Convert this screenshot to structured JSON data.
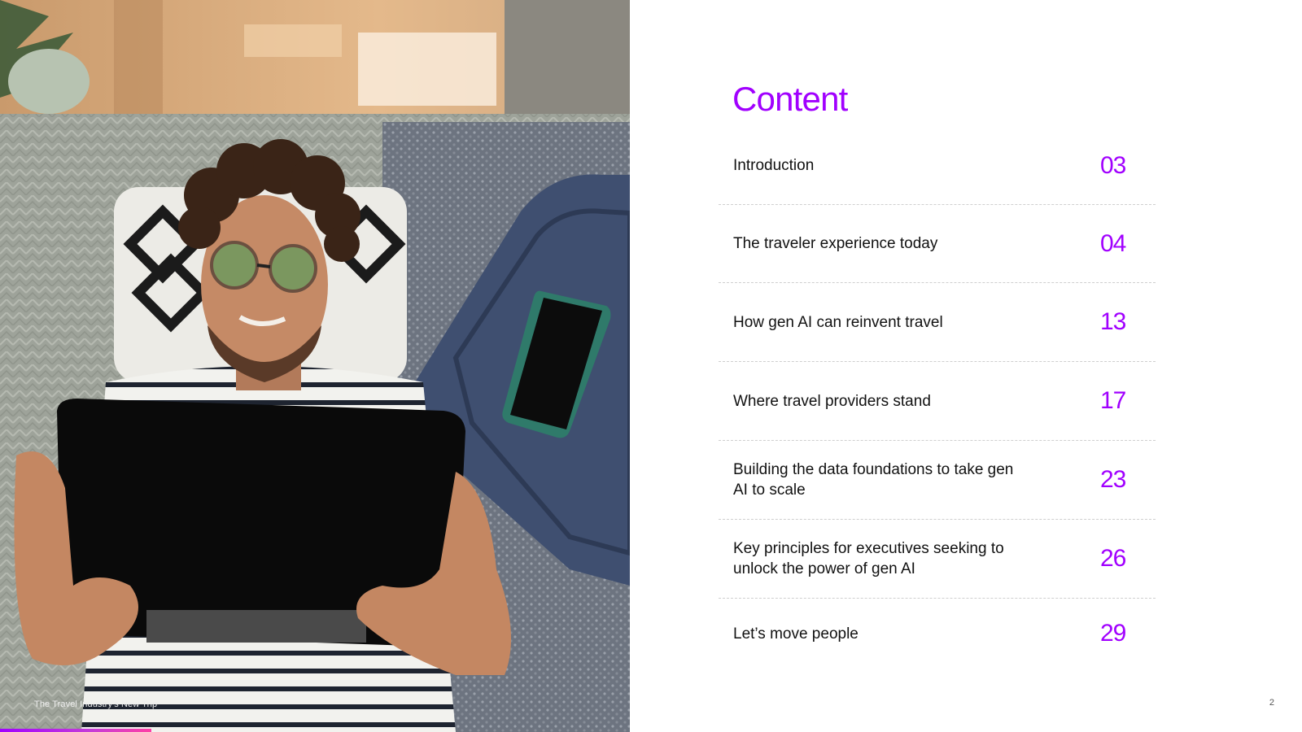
{
  "photo": {
    "alt": "Man lying on a sofa holding a tablet next to a suitcase and phone",
    "footer_text": "The Travel Industry's New Trip"
  },
  "colors": {
    "accent": "#a100ff",
    "accent_pink": "#ff3ea5",
    "text": "#111111"
  },
  "content": {
    "title": "Content",
    "items": [
      {
        "label": "Introduction",
        "page": "03"
      },
      {
        "label": "The traveler experience today",
        "page": "04"
      },
      {
        "label": "How gen AI can reinvent travel",
        "page": "13"
      },
      {
        "label": "Where travel providers stand",
        "page": "17"
      },
      {
        "label": "Building the data foundations to take gen AI to scale",
        "page": "23"
      },
      {
        "label": "Key principles for executives seeking to unlock the power of gen AI",
        "page": "26"
      },
      {
        "label": "Let’s move people",
        "page": "29"
      }
    ]
  },
  "page_number": "2"
}
